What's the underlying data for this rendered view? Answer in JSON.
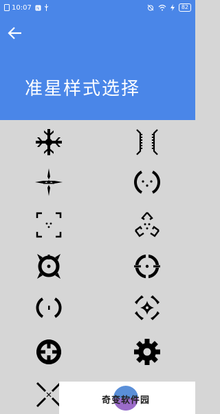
{
  "status_bar": {
    "time": "10:07",
    "battery": "82"
  },
  "header": {
    "title": "准星样式选择"
  },
  "crosshairs": [
    {
      "icon": "snowflake-crosshair-icon"
    },
    {
      "icon": "bracket-crosshair-icon"
    },
    {
      "icon": "blade-cross-crosshair-icon"
    },
    {
      "icon": "dot-ring-crosshair-icon"
    },
    {
      "icon": "corner-brackets-crosshair-icon"
    },
    {
      "icon": "tri-wing-crosshair-icon"
    },
    {
      "icon": "gear-ring-crosshair-icon"
    },
    {
      "icon": "circle-cross-crosshair-icon"
    },
    {
      "icon": "parentheses-dot-crosshair-icon"
    },
    {
      "icon": "concave-diamond-crosshair-icon"
    },
    {
      "icon": "thick-circle-cross-crosshair-icon"
    },
    {
      "icon": "gear-crosshair-icon"
    },
    {
      "icon": "x-cross-crosshair-icon"
    }
  ],
  "watermark": {
    "text": "奇变软件园"
  },
  "colors": {
    "header": "#4a86e8",
    "background": "#d6d6d6",
    "icon": "#000000"
  }
}
